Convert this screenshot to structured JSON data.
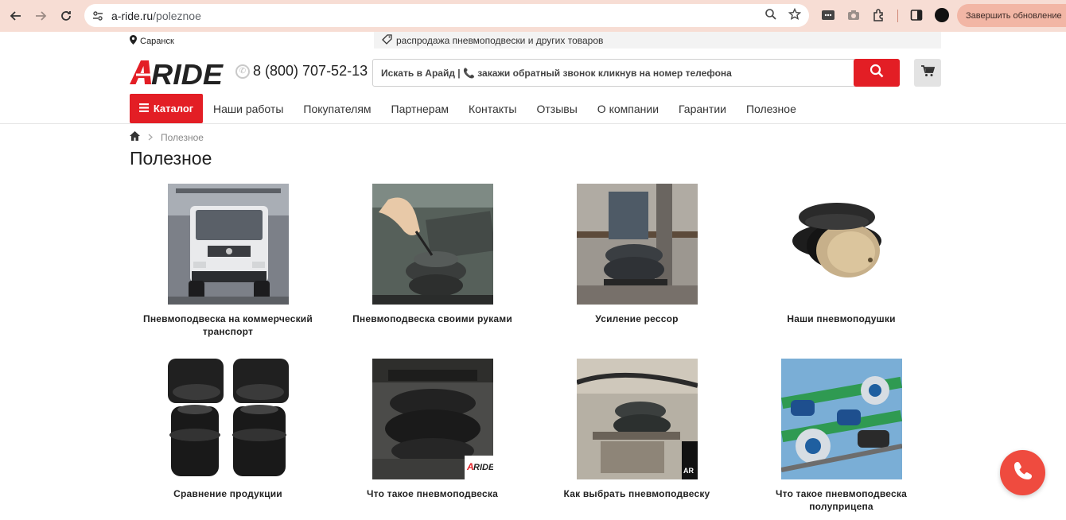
{
  "browser": {
    "url_host": "a-ride.ru",
    "url_path": "/poleznoe",
    "update_label": "Завершить обновление"
  },
  "topbar": {
    "city": "Саранск",
    "promo": "распродажа пневмоподвески и других товаров"
  },
  "header": {
    "phone": "8 (800) 707-52-13",
    "search_placeholder": "Искать в Арайд | 📞 закажи обратный звонок кликнув на номер телефона"
  },
  "menu": {
    "catalog": "Каталог",
    "items": [
      "Наши работы",
      "Покупателям",
      "Партнерам",
      "Контакты",
      "Отзывы",
      "О компании",
      "Гарантии",
      "Полезное"
    ]
  },
  "breadcrumb": {
    "current": "Полезное"
  },
  "page": {
    "title": "Полезное"
  },
  "articles": [
    {
      "title": "Пневмоподвеска на коммерческий транспорт"
    },
    {
      "title": "Пневмоподвеска своими руками"
    },
    {
      "title": "Усиление рессор"
    },
    {
      "title": "Наши пневмоподушки"
    },
    {
      "title": "Сравнение продукции"
    },
    {
      "title": "Что такое пневмоподвеска"
    },
    {
      "title": "Как выбрать пневмоподвеску"
    },
    {
      "title": "Что такое пневмоподвеска полуприцепа"
    }
  ],
  "colors": {
    "brand_red": "#e31e25",
    "chrome_bg": "#f7ddd4",
    "fab": "#ef4b3f"
  }
}
